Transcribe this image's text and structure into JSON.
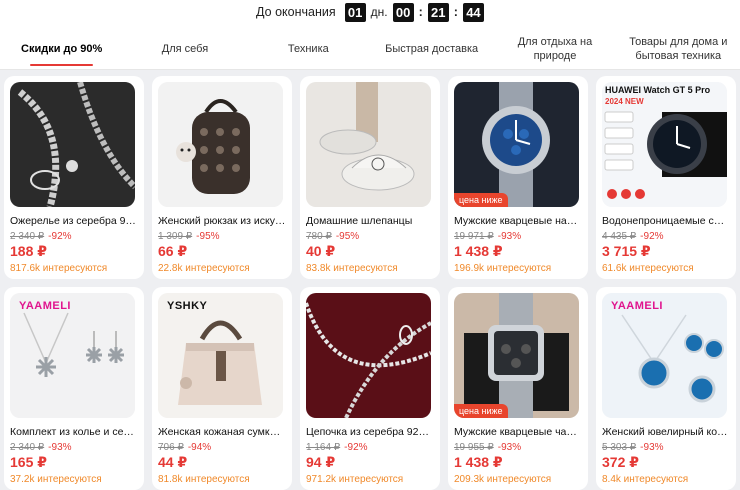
{
  "timer": {
    "label": "До окончания",
    "days": "01",
    "days_unit": "дн.",
    "hours": "00",
    "minutes": "21",
    "seconds": "44",
    "sep": ":"
  },
  "tabs": [
    {
      "label": "Скидки до 90%",
      "active": true
    },
    {
      "label": "Для себя"
    },
    {
      "label": "Техника"
    },
    {
      "label": "Быстрая доставка"
    },
    {
      "label": "Для отдыха на природе"
    },
    {
      "label": "Товары для дома и бытовая техника"
    }
  ],
  "products": [
    {
      "title": "Ожерелье из серебра 925 …",
      "old_price": "2 340 ₽",
      "discount": "-92%",
      "price": "188 ₽",
      "interest": "817.6k интересуются",
      "icon": "silver-chain-necklace"
    },
    {
      "title": "Женский рюкзак из искусст…",
      "old_price": "1 309 ₽",
      "discount": "-95%",
      "price": "66 ₽",
      "interest": "22.8k интересуются",
      "icon": "backpack"
    },
    {
      "title": "Домашние шлепанцы",
      "old_price": "780 ₽",
      "discount": "-95%",
      "price": "40 ₽",
      "interest": "83.8k интересуются",
      "icon": "slippers"
    },
    {
      "title": "Мужские кварцевые наруч…",
      "old_price": "19 971 ₽",
      "discount": "-93%",
      "price": "1 438 ₽",
      "interest": "196.9k интересуются",
      "badge": "цена ниже",
      "icon": "wristwatch"
    },
    {
      "title": "Водонепроницаемые смарт…",
      "old_price": "4 435 ₽",
      "discount": "-92%",
      "price": "3 715 ₽",
      "interest": "61.6k интересуются",
      "image_text": "HUAWEI Watch GT 5 Pro",
      "image_subtext": "2024 NEW",
      "icon": "smartwatch"
    },
    {
      "title": "Комплект из колье и серёж…",
      "old_price": "2 340 ₽",
      "discount": "-93%",
      "price": "165 ₽",
      "interest": "37.2k интересуются",
      "brand": "YAAMELI",
      "icon": "snowflake-jewelry"
    },
    {
      "title": "Женская кожаная сумка че…",
      "old_price": "706 ₽",
      "discount": "-94%",
      "price": "44 ₽",
      "interest": "81.8k интересуются",
      "brand": "YSHKY",
      "icon": "handbag"
    },
    {
      "title": "Цепочка из серебра 925 пр…",
      "old_price": "1 164 ₽",
      "discount": "-92%",
      "price": "94 ₽",
      "interest": "971.2k интересуются",
      "icon": "silver-chain"
    },
    {
      "title": "Мужские кварцевые часы с…",
      "old_price": "19 955 ₽",
      "discount": "-93%",
      "price": "1 438 ₽",
      "interest": "209.3k интересуются",
      "badge": "цена ниже",
      "icon": "square-watch"
    },
    {
      "title": "Женский ювелирный компл…",
      "old_price": "5 303 ₽",
      "discount": "-93%",
      "price": "372 ₽",
      "interest": "8.4k интересуются",
      "brand": "YAAMELI",
      "icon": "blue-gem-jewelry"
    }
  ],
  "colors": {
    "accent": "#e53935",
    "interest": "#f0892a",
    "badge": "#e8452d"
  }
}
